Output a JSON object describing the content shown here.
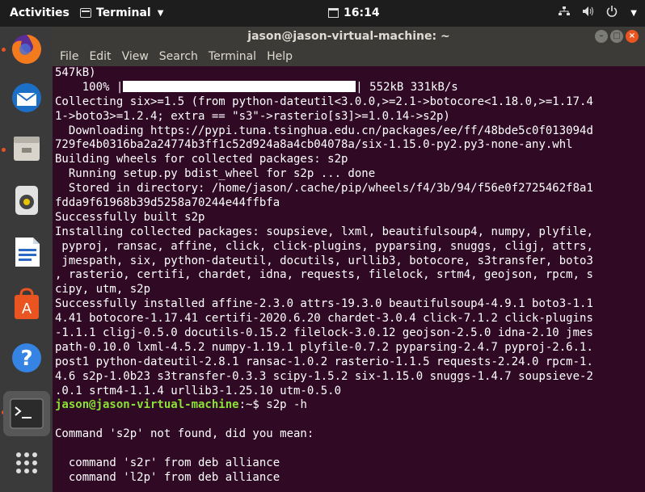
{
  "topbar": {
    "activities": "Activities",
    "app_name": "Terminal",
    "clock": "16:14"
  },
  "window": {
    "title": "jason@jason-virtual-machine: ~",
    "menu": [
      "File",
      "Edit",
      "View",
      "Search",
      "Terminal",
      "Help"
    ]
  },
  "terminal": {
    "lines": [
      "547kB)",
      "    100% |",
      "Collecting six>=1.5 (from python-dateutil<3.0.0,>=2.1->botocore<1.18.0,>=1.17.4",
      "1->boto3>=1.2.4; extra == \"s3\"->rasterio[s3]>=1.0.14->s2p)",
      "  Downloading https://pypi.tuna.tsinghua.edu.cn/packages/ee/ff/48bde5c0f013094d",
      "729fe4b0316ba2a24774b3ff1c52d924a8a4cb04078a/six-1.15.0-py2.py3-none-any.whl",
      "Building wheels for collected packages: s2p",
      "  Running setup.py bdist_wheel for s2p ... done",
      "  Stored in directory: /home/jason/.cache/pip/wheels/f4/3b/94/f56e0f2725462f8a1",
      "fdda9f61968b39d5258a70244e44ffbfa",
      "Successfully built s2p",
      "Installing collected packages: soupsieve, lxml, beautifulsoup4, numpy, plyfile,",
      " pyproj, ransac, affine, click, click-plugins, pyparsing, snuggs, cligj, attrs,",
      " jmespath, six, python-dateutil, docutils, urllib3, botocore, s3transfer, boto3",
      ", rasterio, certifi, chardet, idna, requests, filelock, srtm4, geojson, rpcm, s",
      "cipy, utm, s2p",
      "Successfully installed affine-2.3.0 attrs-19.3.0 beautifulsoup4-4.9.1 boto3-1.1",
      "4.41 botocore-1.17.41 certifi-2020.6.20 chardet-3.0.4 click-7.1.2 click-plugins",
      "-1.1.1 cligj-0.5.0 docutils-0.15.2 filelock-3.0.12 geojson-2.5.0 idna-2.10 jmes",
      "path-0.10.0 lxml-4.5.2 numpy-1.19.1 plyfile-0.7.2 pyparsing-2.4.7 pyproj-2.6.1.",
      "post1 python-dateutil-2.8.1 ransac-1.0.2 rasterio-1.1.5 requests-2.24.0 rpcm-1.",
      "4.6 s2p-1.0b23 s3transfer-0.3.3 scipy-1.5.2 six-1.15.0 snuggs-1.4.7 soupsieve-2",
      ".0.1 srtm4-1.1.4 urllib3-1.25.10 utm-0.5.0"
    ],
    "progress_tail": "| 552kB 331kB/s",
    "progress_fraction": 1.0,
    "prompt_user": "jason@jason-virtual-machine",
    "prompt_sep": ":~$ ",
    "command": "s2p -h",
    "after": [
      "",
      "Command 's2p' not found, did you mean:",
      "",
      "  command 's2r' from deb alliance",
      "  command 'l2p' from deb alliance"
    ]
  },
  "dock": [
    "firefox-icon",
    "thunderbird-icon",
    "files-icon",
    "rhythmbox-icon",
    "writer-icon",
    "software-center-icon",
    "help-icon",
    "terminal-icon",
    "app-grid-icon"
  ],
  "colors": {
    "accent": "#e95420",
    "terminal_bg": "#300a24",
    "prompt_user": "#8ae234",
    "prompt_path": "#729fcf"
  }
}
